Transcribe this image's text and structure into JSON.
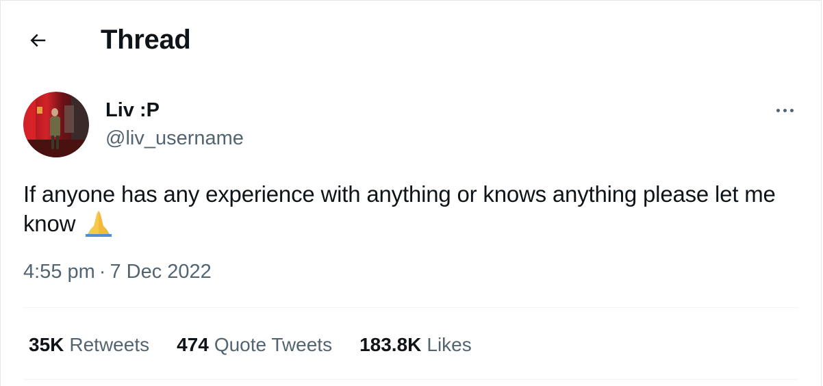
{
  "header": {
    "title": "Thread",
    "back_icon": "arrow-left-icon"
  },
  "author": {
    "display_name": "Liv :P",
    "handle": "@liv_username",
    "avatar_icon": "profile-photo",
    "more_icon": "more-horizontal-icon"
  },
  "tweet": {
    "text": "If anyone has any experience with anything or knows anything please let me know",
    "emoji_icon": "folded-hands-emoji",
    "time": "4:55 pm",
    "separator": "·",
    "date": "7 Dec 2022"
  },
  "stats": {
    "retweets_count": "35K",
    "retweets_label": "Retweets",
    "quotes_count": "474",
    "quotes_label": "Quote Tweets",
    "likes_count": "183.8K",
    "likes_label": "Likes"
  },
  "colors": {
    "text_primary": "#0f1419",
    "text_secondary": "#536471",
    "divider": "#eff3f4"
  }
}
